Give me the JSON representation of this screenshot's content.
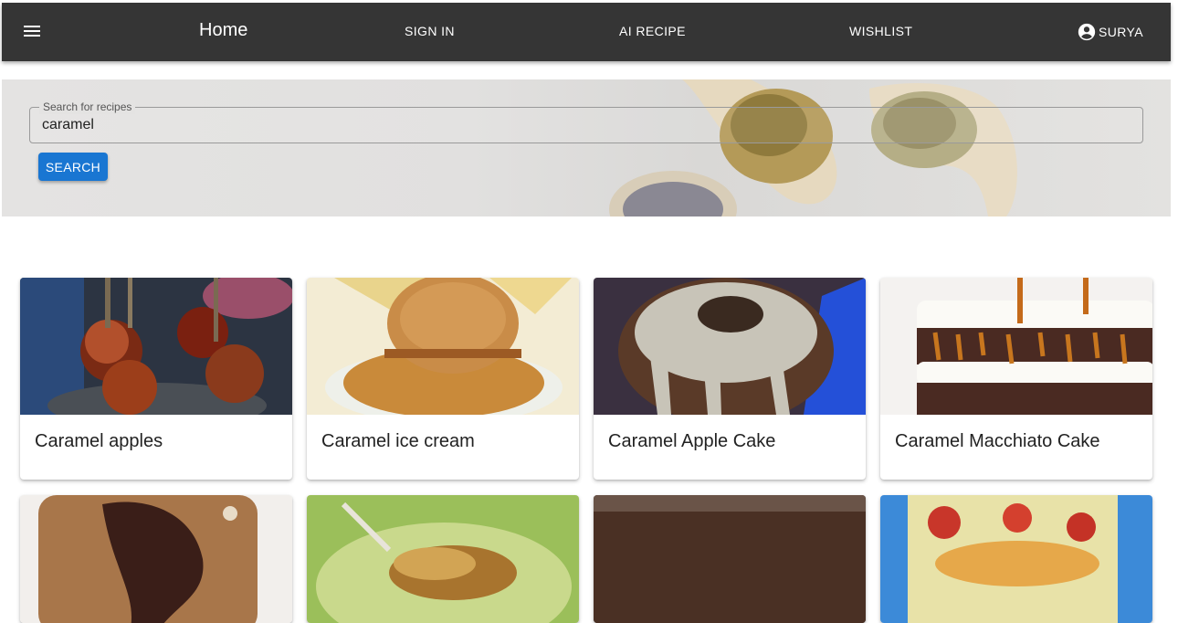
{
  "nav": {
    "home": "Home",
    "sign_in": "SIGN IN",
    "ai_recipe": "AI RECIPE",
    "wishlist": "WISHLIST",
    "user": "SURYA"
  },
  "search": {
    "label": "Search for recipes",
    "value": "caramel",
    "button": "SEARCH"
  },
  "recipes": [
    {
      "title": "Caramel apples"
    },
    {
      "title": "Caramel ice cream"
    },
    {
      "title": "Caramel Apple Cake"
    },
    {
      "title": "Caramel Macchiato Cake"
    }
  ],
  "colors": {
    "appbar": "#353535",
    "primary": "#1976d2"
  }
}
